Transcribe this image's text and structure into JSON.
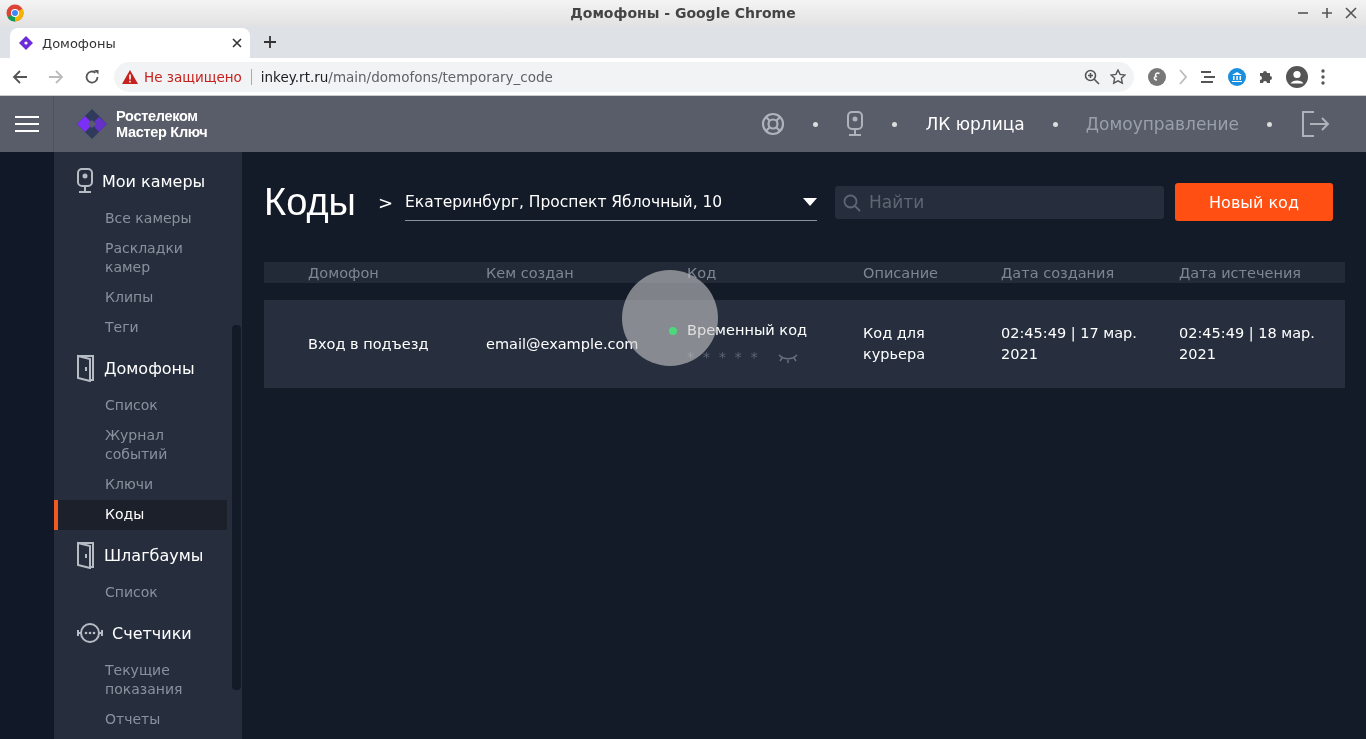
{
  "browser": {
    "window_title": "Домофоны - Google Chrome",
    "tab_title": "Домофоны",
    "security_label": "Не защищено",
    "url_host": "inkey.rt.ru",
    "url_path": "/main/domofons/temporary_code"
  },
  "header": {
    "brand": [
      "Ростелеком",
      "Мастер Ключ"
    ],
    "nav": [
      {
        "kind": "lifebuoy"
      },
      {
        "kind": "camera"
      },
      {
        "kind": "link",
        "label": "ЛК юрлица",
        "selected": true
      },
      {
        "kind": "link",
        "label": "Домоуправление",
        "selected": false
      },
      {
        "kind": "logout"
      }
    ]
  },
  "sidebar": {
    "sections": [
      {
        "title": "Мои камеры",
        "kind": "camera",
        "items": [
          {
            "label": "Все камеры",
            "selected": false
          },
          {
            "label": "Раскладки камер",
            "selected": false
          },
          {
            "label": "Клипы",
            "selected": false
          },
          {
            "label": "Теги",
            "selected": false
          }
        ]
      },
      {
        "title": "Домофоны",
        "kind": "door",
        "items": [
          {
            "label": "Список",
            "selected": false
          },
          {
            "label": "Журнал событий",
            "selected": false
          },
          {
            "label": "Ключи",
            "selected": false
          },
          {
            "label": "Коды",
            "selected": true
          }
        ]
      },
      {
        "title": "Шлагбаумы",
        "kind": "door",
        "items": [
          {
            "label": "Список",
            "selected": false
          }
        ]
      },
      {
        "title": "Счетчики",
        "kind": "meter",
        "items": [
          {
            "label": "Текущие показания",
            "selected": false
          },
          {
            "label": "Отчеты",
            "selected": false
          }
        ]
      }
    ]
  },
  "page": {
    "title": "Коды",
    "breadcrumb_separator": ">",
    "address": "Екатеринбург, Проспект Яблочный, 10",
    "search_placeholder": "Найти",
    "new_button": "Новый код"
  },
  "table": {
    "columns": [
      "Домофон",
      "Кем создан",
      "Код",
      "Описание",
      "Дата создания",
      "Дата истечения"
    ],
    "rows": [
      {
        "intercom": "Вход в подъезд",
        "created_by": "email@example.com",
        "code_type": "Временный код",
        "color": "#4cd97b",
        "code": "* * * * *",
        "description": "Код для курьера",
        "created": "02:45:49 | 17 мар. 2021",
        "expires": "02:45:49 | 18 мар. 2021"
      }
    ]
  }
}
